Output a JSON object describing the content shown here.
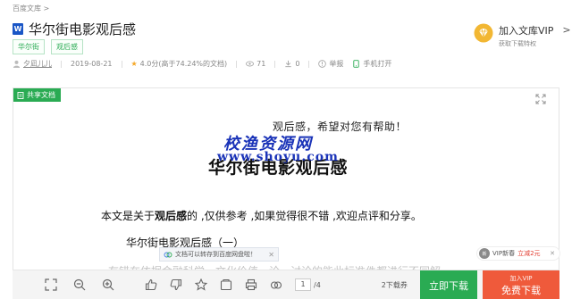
{
  "breadcrumb": "百度文库 >",
  "doc": {
    "badge": "W",
    "title": "华尔街电影观后感",
    "tags": [
      "华尔街",
      "观后感"
    ]
  },
  "meta": {
    "author": "夕凪儿儿",
    "date": "2019-08-21",
    "rating": "4.0分(高于74.24%的文档)",
    "views": "71",
    "downloads": "0",
    "report": "举报",
    "mobile_open": "手机打开"
  },
  "vip_join": {
    "title": "加入文库VIP",
    "subtitle": "获取下载特权",
    "arrow": ">"
  },
  "share_badge": "共享文档",
  "content": {
    "line1": "观后感，希望对您有帮助！",
    "watermark_cn": "校渔资源网",
    "watermark_url": "www.shoyu.com",
    "heading": "华尔街电影观后感",
    "intro_prefix": "本文是关于",
    "intro_bold": "观后感",
    "intro_suffix": "的 ,仅供参考 ,如果觉得很不错 ,欢迎点评和分享。",
    "subheading": "华尔街电影观后感（一）",
    "cut_line": "有错在依据金融科学，文化价值，论、讨论的能此标准件都进行不同解"
  },
  "netdisk_tip": {
    "text": "文档可以转存到百度网盘啦！",
    "close": "✕"
  },
  "vip_promo": {
    "dot": "新",
    "label": "VIP新春",
    "highlight": "立减2元",
    "close": "✕"
  },
  "toolbar": {
    "page_current": "1",
    "page_total": "/4",
    "vouchers": "2下载券",
    "download_label": "立即下载",
    "vip_small": "加入VIP",
    "vip_big": "免费下载"
  }
}
